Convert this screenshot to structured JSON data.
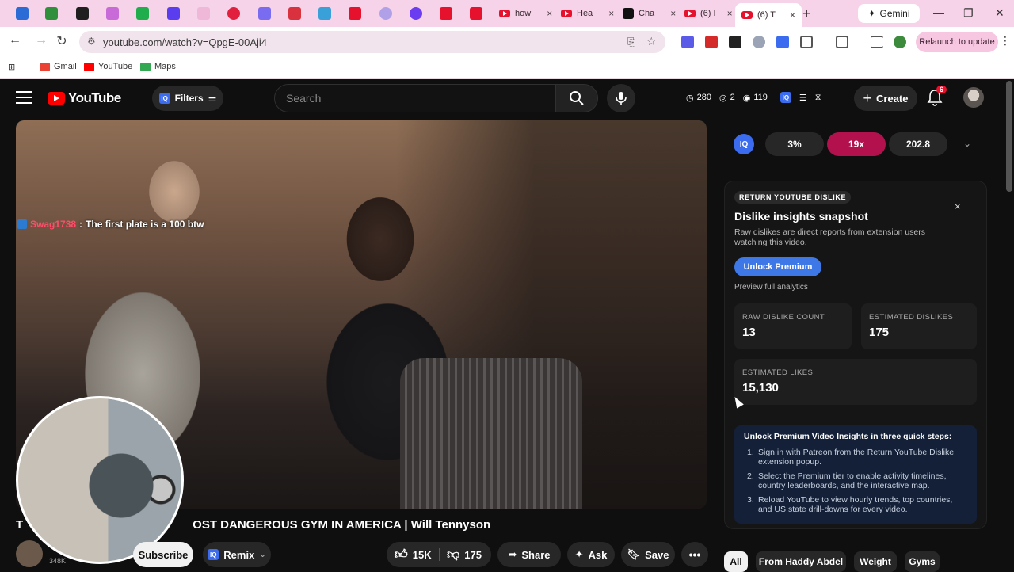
{
  "browser": {
    "tabs": [
      {
        "label": "how",
        "close": "×"
      },
      {
        "label": "Hea",
        "close": "×"
      },
      {
        "label": "Cha",
        "close": "×"
      },
      {
        "label": "(6) I",
        "close": "×"
      },
      {
        "label": "(6) T",
        "close": "×"
      }
    ],
    "new_tab": "+",
    "gemini_label": "Gemini",
    "window_controls": {
      "minimize": "—",
      "restore": "❐",
      "close": "✕"
    },
    "url": "youtube.com/watch?v=QpgE-00Aji4",
    "relaunch_label": "Relaunch to update",
    "bookmarks": [
      {
        "label": "Gmail",
        "color": "#ea4335"
      },
      {
        "label": "YouTube",
        "color": "#ff0000"
      },
      {
        "label": "Maps",
        "color": "#34a853"
      }
    ]
  },
  "masthead": {
    "logo_text": "YouTube",
    "filters_label": "Filters",
    "search_placeholder": "Search",
    "stats": {
      "watch": "280",
      "eye": "2",
      "views": "119"
    },
    "create_label": "Create",
    "notifications": "6"
  },
  "video": {
    "chat": {
      "user": "Swag1738",
      "separator": ":",
      "message": "The first plate is a 100 btw"
    },
    "title": "THE MOST DANGEROUS GYM IN AMERICA | Will Tennyson",
    "title_visible": "T",
    "title_rest": "OST DANGEROUS GYM IN AMERICA | Will Tennyson",
    "subscribers": "348K",
    "subscribe_label": "Subscribe",
    "remix_label": "Remix",
    "likes": "15K",
    "dislikes": "175",
    "share_label": "Share",
    "ask_label": "Ask",
    "save_label": "Save",
    "more_label": "•••"
  },
  "iq_metrics": {
    "logo": "IQ",
    "chips": [
      "3%",
      "19x",
      "202.8"
    ],
    "caret": "⌄"
  },
  "ryd_panel": {
    "tag": "RETURN YOUTUBE DISLIKE",
    "close": "×",
    "heading": "Dislike insights snapshot",
    "description": "Raw dislikes are direct reports from extension users watching this video.",
    "unlock_label": "Unlock Premium",
    "preview_label": "Preview full analytics",
    "stats": [
      {
        "label": "RAW DISLIKE COUNT",
        "value": "13"
      },
      {
        "label": "ESTIMATED DISLIKES",
        "value": "175"
      },
      {
        "label": "ESTIMATED LIKES",
        "value": "15,130"
      }
    ],
    "steps_heading": "Unlock Premium Video Insights in three quick steps:",
    "steps": [
      {
        "n": "1.",
        "text": "Sign in with Patreon from the Return YouTube Dislike extension popup."
      },
      {
        "n": "2.",
        "text": "Select the Premium tier to enable activity timelines, country leaderboards, and the interactive map."
      },
      {
        "n": "3.",
        "text": "Reload YouTube to view hourly trends, top countries, and US state drill-downs for every video."
      }
    ]
  },
  "chips": [
    "All",
    "From Haddy Abdel",
    "Weight",
    "Gyms"
  ]
}
